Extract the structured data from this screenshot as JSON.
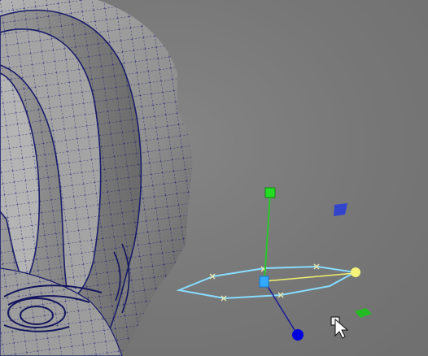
{
  "viewport": {
    "background_color": "#777777",
    "mesh": {
      "description_icon": "wireframe-mesh-icon",
      "surface_color": "#9a9a9a",
      "wire_color": "#1a1a6e",
      "selected_edge_color": "#20208a"
    },
    "manipulator": {
      "type": "move-rotate-scale-gizmo",
      "y_handle_color": "#22cc22",
      "z_handle_color": "#0000cc",
      "x_handle_color": "#f0f070",
      "center_handle_color": "#33aaff",
      "plane_handle_xy_color": "#3344cc",
      "plane_handle_xz_color": "#22bb22",
      "ring_color": "#88ddff"
    },
    "cursor": {
      "icon": "arrow-cursor-icon",
      "badge_icon": "scale-box-icon"
    }
  }
}
